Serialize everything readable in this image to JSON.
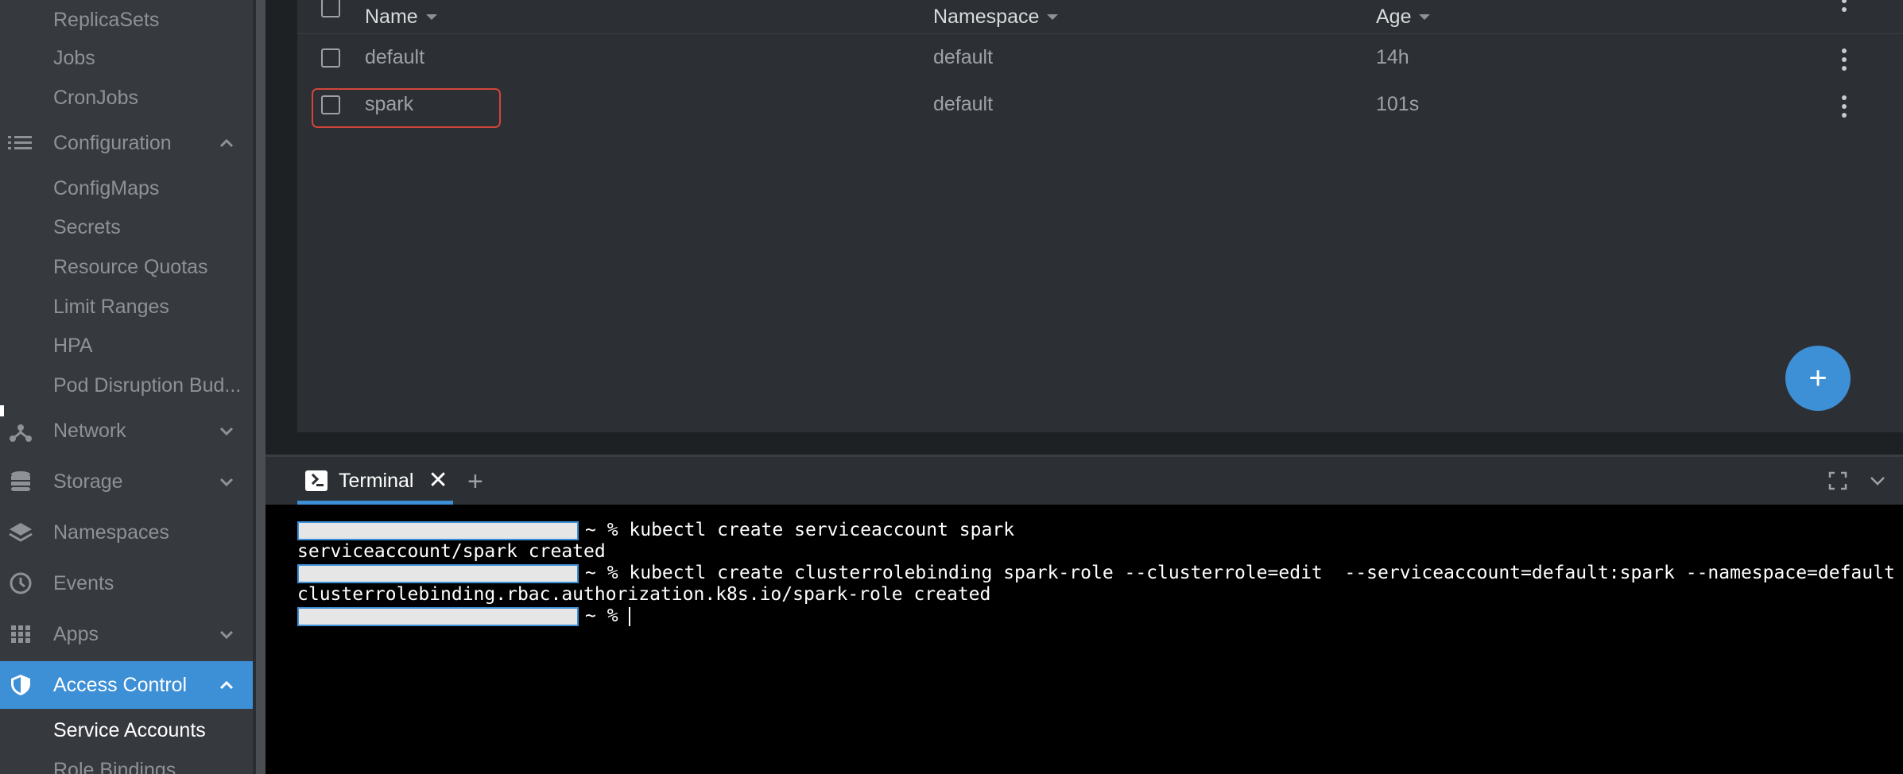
{
  "sidebar": {
    "workload_sub": [
      "ReplicaSets",
      "Jobs",
      "CronJobs"
    ],
    "configuration": {
      "label": "Configuration",
      "icon": "list-icon",
      "items": [
        "ConfigMaps",
        "Secrets",
        "Resource Quotas",
        "Limit Ranges",
        "HPA",
        "Pod Disruption Bud..."
      ]
    },
    "network": {
      "label": "Network",
      "icon": "network-icon"
    },
    "storage": {
      "label": "Storage",
      "icon": "storage-icon"
    },
    "namespaces": {
      "label": "Namespaces",
      "icon": "layers-icon"
    },
    "events": {
      "label": "Events",
      "icon": "clock-icon"
    },
    "apps": {
      "label": "Apps",
      "icon": "apps-grid-icon"
    },
    "access_control": {
      "label": "Access Control",
      "icon": "shield-icon",
      "items": [
        "Service Accounts",
        "Role Bindings"
      ]
    }
  },
  "table": {
    "columns": [
      "Name",
      "Namespace",
      "Age"
    ],
    "rows": [
      {
        "name": "default",
        "namespace": "default",
        "age": "14h"
      },
      {
        "name": "spark",
        "namespace": "default",
        "age": "101s"
      }
    ]
  },
  "fab": {
    "label": "+"
  },
  "dock": {
    "tab_label": "Terminal",
    "close": "✕",
    "add": "+"
  },
  "terminal": {
    "lines": [
      {
        "prompt": "~ % ",
        "text": "kubectl create serviceaccount spark"
      },
      {
        "prompt": "",
        "text": "serviceaccount/spark created"
      },
      {
        "prompt": "~ % ",
        "text": "kubectl create clusterrolebinding spark-role --clusterrole=edit  --serviceaccount=default:spark --namespace=default"
      },
      {
        "prompt": "",
        "text": "clusterrolebinding.rbac.authorization.k8s.io/spark-role created"
      },
      {
        "prompt": "~ % ",
        "text": ""
      }
    ]
  },
  "colors": {
    "accent": "#3d8fd6",
    "highlight": "#d0463c",
    "sidebar": "#36393e",
    "panel": "#2c2f33"
  }
}
